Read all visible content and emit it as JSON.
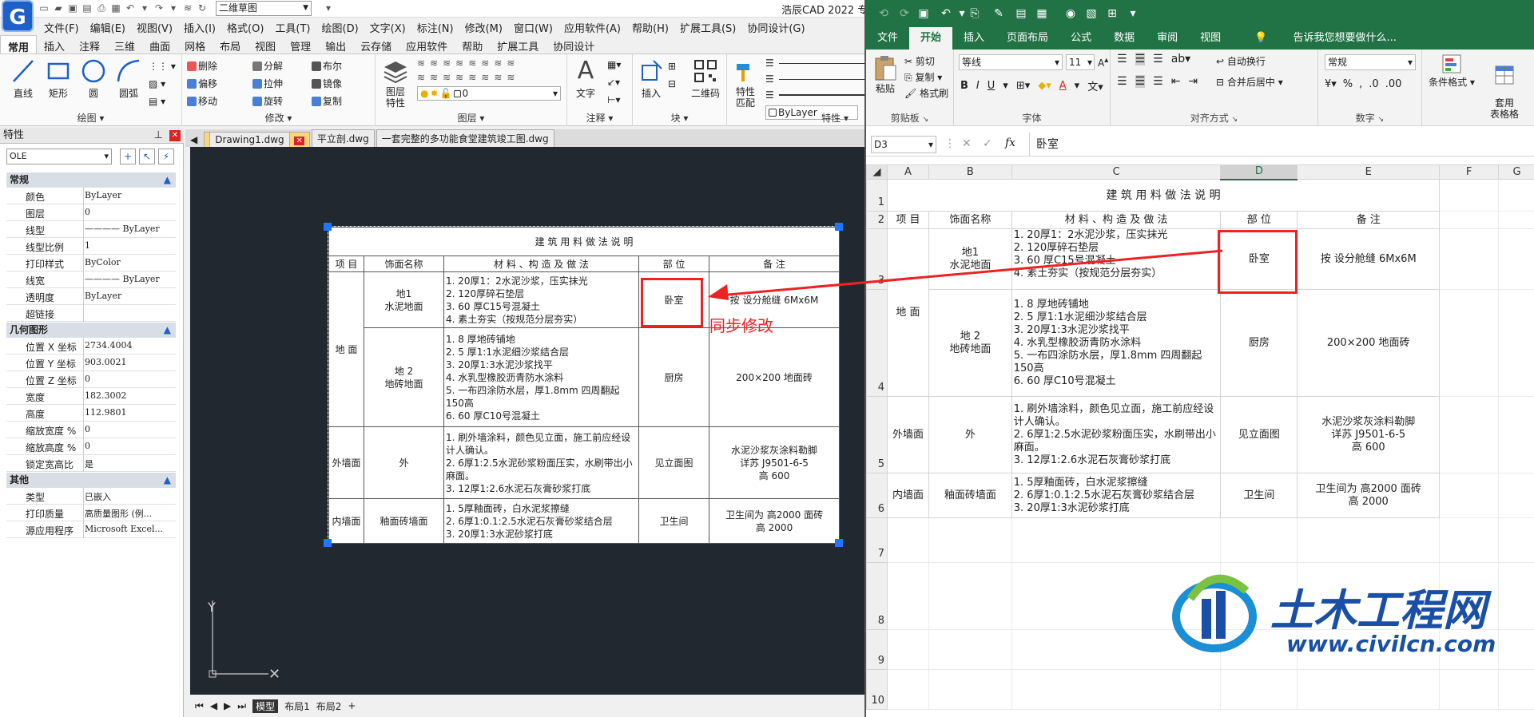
{
  "cad": {
    "app_title": "浩辰CAD 2022 专",
    "workspace": "二维草图",
    "menu": [
      "文件(F)",
      "编辑(E)",
      "视图(V)",
      "插入(I)",
      "格式(O)",
      "工具(T)",
      "绘图(D)",
      "文字(X)",
      "标注(N)",
      "修改(M)",
      "窗口(W)",
      "应用软件(A)",
      "帮助(H)",
      "扩展工具(S)",
      "协同设计(G)"
    ],
    "ribbon_tabs": [
      "常用",
      "插入",
      "注释",
      "三维",
      "曲面",
      "网格",
      "布局",
      "视图",
      "管理",
      "输出",
      "云存储",
      "应用软件",
      "帮助",
      "扩展工具",
      "协同设计"
    ],
    "ribbon": {
      "draw_label": "绘图",
      "draw_buttons": [
        "直线",
        "矩形",
        "圆",
        "圆弧"
      ],
      "modify_label": "修改",
      "modify_items": [
        "删除",
        "分解",
        "布尔",
        "偏移",
        "拉伸",
        "镜像",
        "移动",
        "旋转",
        "复制"
      ],
      "layer_label": "图层",
      "layer_btn": "图层\n特性",
      "layer_value": "0",
      "annot_label": "注释",
      "text_btn": "文字",
      "block_label": "块",
      "insert_btn": "插入",
      "qr_btn": "二维码",
      "props_label": "特性",
      "match_btn": "特性\n匹配",
      "bylayer": "ByLayer"
    },
    "properties": {
      "title": "特性",
      "selection": "OLE",
      "sections": {
        "general": "常规",
        "geometry": "几何图形",
        "other": "其他"
      },
      "general_rows": [
        {
          "k": "颜色",
          "v": "ByLayer"
        },
        {
          "k": "图层",
          "v": "0"
        },
        {
          "k": "线型",
          "v": "———— ByLayer"
        },
        {
          "k": "线型比例",
          "v": "1"
        },
        {
          "k": "打印样式",
          "v": "ByColor"
        },
        {
          "k": "线宽",
          "v": "———— ByLayer"
        },
        {
          "k": "透明度",
          "v": "ByLayer"
        },
        {
          "k": "超链接",
          "v": ""
        }
      ],
      "geometry_rows": [
        {
          "k": "位置 X 坐标",
          "v": "2734.4004"
        },
        {
          "k": "位置 Y 坐标",
          "v": "903.0021"
        },
        {
          "k": "位置 Z 坐标",
          "v": "0"
        },
        {
          "k": "宽度",
          "v": "182.3002"
        },
        {
          "k": "高度",
          "v": "112.9801"
        },
        {
          "k": "缩放宽度 %",
          "v": "0"
        },
        {
          "k": "缩放高度 %",
          "v": "0"
        },
        {
          "k": "锁定宽高比",
          "v": "是"
        }
      ],
      "other_rows": [
        {
          "k": "类型",
          "v": "已嵌入"
        },
        {
          "k": "打印质量",
          "v": "高质量图形 (例..."
        },
        {
          "k": "源应用程序",
          "v": "Microsoft Excel..."
        }
      ]
    },
    "doc_tabs": [
      "Drawing1.dwg",
      "平立剖.dwg",
      "一套完整的多功能食堂建筑竣工图.dwg"
    ],
    "layout_tabs": [
      "模型",
      "布局1",
      "布局2",
      "+"
    ],
    "sync_label": "同步修改"
  },
  "table": {
    "title": "建 筑 用 料 做 法 说 明",
    "headers": [
      "项  目",
      "饰面名称",
      "材 料 、构 造 及 做 法",
      "部  位",
      "备  注"
    ],
    "rows": [
      {
        "cat": "地 面",
        "name": "地1\n水泥地面",
        "mat": "1. 20厚1：2水泥沙浆，压实抹光\n2. 120厚碎石垫层\n3. 60 厚C15号混凝土\n4. 素土夯实（按规范分层夯实）",
        "part": "卧室",
        "note": "按   设分舱缝 6Mx6M"
      },
      {
        "cat": "",
        "name": "地 2\n地砖地面",
        "mat": "1. 8 厚地砖铺地\n2. 5 厚1:1水泥细沙浆结合层\n3. 20厚1:3水泥沙浆找平\n4. 水乳型橡胶沥青防水涂料\n5. 一布四涂防水层，厚1.8mm 四周翻起150高\n6. 60 厚C10号混凝土",
        "part": "厨房",
        "note": "200×200 地面砖"
      },
      {
        "cat": "外墙面",
        "name": "外",
        "mat": "1. 刷外墙涂料，颜色见立面，施工前应经设计人确认。\n2. 6厚1:2.5水泥砂浆粉面压实，水刷带出小麻面。\n3. 12厚1:2.6水泥石灰膏砂浆打底",
        "part": "见立面图",
        "note": "水泥沙浆灰涂料勒脚\n详苏 J9501-6-5\n高 600"
      },
      {
        "cat": "内墙面",
        "name": "釉面砖墙面",
        "mat": "1. 5厚釉面砖，白水泥浆擦缝\n2. 6厚1:0.1:2.5水泥石灰膏砂浆结合层\n3. 20厚1:3水泥砂浆打底",
        "part": "卫生间",
        "note": "卫生间为 高2000 面砖\n高 2000"
      }
    ]
  },
  "excel": {
    "title_tabs": [
      "文件",
      "开始",
      "插入",
      "页面布局",
      "公式",
      "数据",
      "审阅",
      "视图"
    ],
    "tell_me": "告诉我您想要做什么...",
    "clipboard": {
      "label": "剪贴板",
      "paste": "粘贴",
      "cut": "剪切",
      "copy": "复制",
      "format_painter": "格式刷"
    },
    "font": {
      "label": "字体",
      "name": "等线",
      "size": "11"
    },
    "align": {
      "label": "对齐方式",
      "wrap": "自动换行",
      "merge": "合并后居中"
    },
    "number": {
      "label": "数字",
      "format": "常规"
    },
    "styles": {
      "cond": "条件格式",
      "table": "套用\n表格格"
    },
    "name_box": "D3",
    "formula": "卧室",
    "columns": [
      "A",
      "B",
      "C",
      "D",
      "E",
      "F",
      "G"
    ],
    "row_numbers": [
      "1",
      "2",
      "3",
      "4",
      "5",
      "6",
      "7",
      "8",
      "9",
      "10"
    ]
  },
  "watermark": {
    "cn": "土木工程网",
    "url": "www.civilcn.com"
  },
  "colors": {
    "excel_green": "#217346",
    "cad_bg": "#212830",
    "highlight_red": "#e22222",
    "grip_blue": "#1e78ff"
  }
}
